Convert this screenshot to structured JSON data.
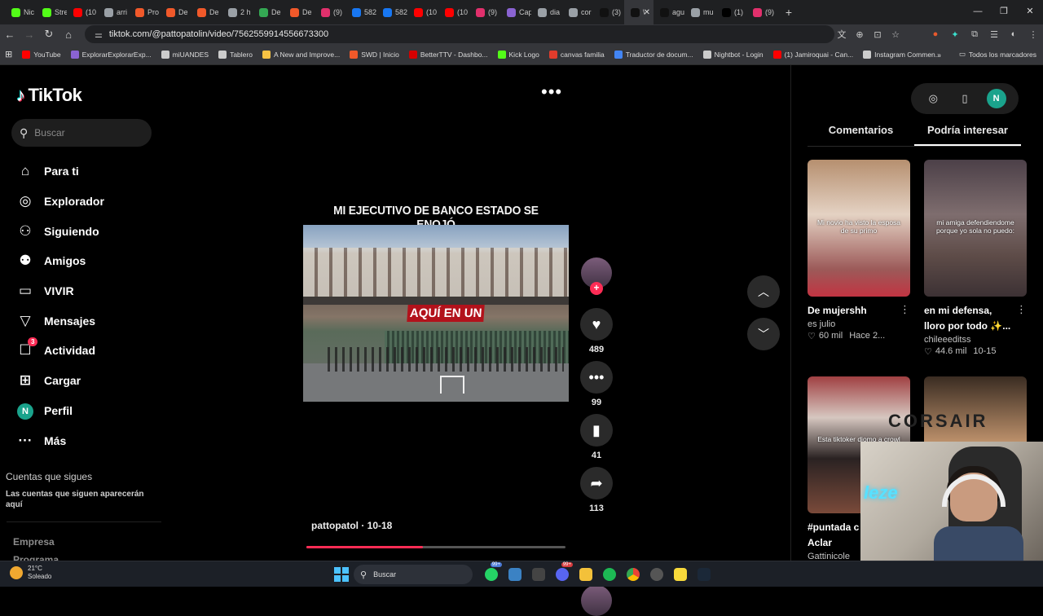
{
  "browser": {
    "tabs": [
      {
        "label": "Nic",
        "color": "#53fc18"
      },
      {
        "label": "Stre",
        "color": "#53fc18"
      },
      {
        "label": "(10",
        "color": "#ff0000"
      },
      {
        "label": "arri",
        "color": "#9aa0a6"
      },
      {
        "label": "Pro",
        "color": "#f1592a"
      },
      {
        "label": "De",
        "color": "#f1592a"
      },
      {
        "label": "De",
        "color": "#f1592a"
      },
      {
        "label": "2 h",
        "color": "#9aa0a6"
      },
      {
        "label": "De",
        "color": "#34a853"
      },
      {
        "label": "De",
        "color": "#f1592a"
      },
      {
        "label": "(9)",
        "color": "#e1306c"
      },
      {
        "label": "582",
        "color": "#1877f2"
      },
      {
        "label": "582",
        "color": "#1877f2"
      },
      {
        "label": "(10",
        "color": "#ff0000"
      },
      {
        "label": "(10",
        "color": "#ff0000"
      },
      {
        "label": "(9)",
        "color": "#e1306c"
      },
      {
        "label": "Cap",
        "color": "#8a63d2"
      },
      {
        "label": "dia",
        "color": "#9aa0a6"
      },
      {
        "label": "cor",
        "color": "#9aa0a6"
      },
      {
        "label": "(3)",
        "color": "#111111"
      },
      {
        "label": "\\",
        "color": "#111111",
        "active": true
      },
      {
        "label": "agu",
        "color": "#111111"
      },
      {
        "label": "mu",
        "color": "#9aa0a6"
      },
      {
        "label": "(1)",
        "color": "#000000"
      },
      {
        "label": "(9)",
        "color": "#e1306c"
      }
    ],
    "url": "tiktok.com/@pattopatolin/video/7562559914556673300",
    "bookmarks": [
      {
        "label": "YouTube",
        "color": "#ff0000"
      },
      {
        "label": "ExplorarExplorarExp...",
        "color": "#8a63d2"
      },
      {
        "label": "miUANDES",
        "color": "#cccccc"
      },
      {
        "label": "Tablero",
        "color": "#cccccc"
      },
      {
        "label": "A New and Improve...",
        "color": "#f6c244"
      },
      {
        "label": "SWD | Inicio",
        "color": "#f1592a"
      },
      {
        "label": "BetterTTV - Dashbo...",
        "color": "#d50000"
      },
      {
        "label": "Kick Logo",
        "color": "#53fc18"
      },
      {
        "label": "canvas familia",
        "color": "#e13c2c"
      },
      {
        "label": "Traductor de docum...",
        "color": "#4285f4"
      },
      {
        "label": "Nightbot - Login",
        "color": "#cccccc"
      },
      {
        "label": "(1) Jamiroquai - Can...",
        "color": "#ff0000"
      },
      {
        "label": "Instagram Commen...",
        "color": "#cccccc"
      }
    ],
    "all_bookmarks": "Todos los marcadores"
  },
  "tiktok": {
    "logo": "TikTok",
    "search_placeholder": "Buscar",
    "nav": [
      {
        "name": "para-ti",
        "label": "Para ti",
        "icon": "home-icon",
        "glyph": "⌂"
      },
      {
        "name": "explorador",
        "label": "Explorador",
        "icon": "compass-icon",
        "glyph": "◎"
      },
      {
        "name": "siguiendo",
        "label": "Siguiendo",
        "icon": "user-follow-icon",
        "glyph": "⚇"
      },
      {
        "name": "amigos",
        "label": "Amigos",
        "icon": "friends-icon",
        "glyph": "⚉"
      },
      {
        "name": "vivir",
        "label": "VIVIR",
        "icon": "live-icon",
        "glyph": "▭"
      },
      {
        "name": "mensajes",
        "label": "Mensajes",
        "icon": "send-icon",
        "glyph": "▽"
      },
      {
        "name": "actividad",
        "label": "Actividad",
        "icon": "inbox-icon",
        "glyph": "☐",
        "badge": "3"
      },
      {
        "name": "cargar",
        "label": "Cargar",
        "icon": "upload-icon",
        "glyph": "⊞"
      },
      {
        "name": "perfil",
        "label": "Perfil",
        "icon": "avatar",
        "glyph": "N"
      },
      {
        "name": "mas",
        "label": "Más",
        "icon": "more-icon",
        "glyph": "···"
      }
    ],
    "following_title": "Cuentas que sigues",
    "following_desc": "Las cuentas que siguen aparecerán aquí",
    "footer_links": [
      "Empresa",
      "Programa"
    ],
    "video": {
      "title": "MI EJECUTIVO DE BANCO ESTADO SE ENOJÓ",
      "caption": "AQUÍ EN UN",
      "author_line": "pattopatol · 10-18",
      "progress": 0.45,
      "likes": "489",
      "comments": "99",
      "saves": "41",
      "shares": "113"
    },
    "right_panel": {
      "avatar_letter": "N",
      "tabs": [
        "Comentarios",
        "Podría interesar"
      ],
      "active_tab": 1,
      "cards": [
        {
          "title": "De mujershh",
          "author": "es julio",
          "likes": "60 mil",
          "date": "Hace 2...",
          "overlay": "Mi novio ha visto la esposa de su primo",
          "bg": "linear-gradient(#b68f6f, #e4d2c3 40%, #9c5a59 80%, #c23442)"
        },
        {
          "title": "en mi defensa, lloro por todo ✨...",
          "author": "chileeeditss",
          "likes": "44.6 mil",
          "date": "10-15",
          "overlay": "mi amiga defendiendome porque yo sola no puedo:",
          "bg": "linear-gradient(#4c4048, #7e6d6e 40%, #5e4c48 70%, #3c3134)"
        },
        {
          "title": "#puntada c @Filo Aclar",
          "author": "Gattinicole",
          "likes": "",
          "date": "",
          "overlay": "Esta tiktoker diomo a crowl",
          "bg": "linear-gradient(#a04042, #d6c7c0 30%, #2a2222 60%, #7a4a3a)"
        },
        {
          "title": "",
          "author": "",
          "likes": "",
          "date": "",
          "overlay": "",
          "bg": "linear-gradient(#3a2c22, #c2956e 50%, #8a6a52)"
        }
      ]
    },
    "webcam_brand": "CORSAIR",
    "webcam_neon": "leze"
  },
  "taskbar": {
    "weather_temp": "21°C",
    "weather_desc": "Soleado",
    "search_label": "Buscar",
    "whatsapp_badge": "99+",
    "discord_badge": "99+"
  }
}
